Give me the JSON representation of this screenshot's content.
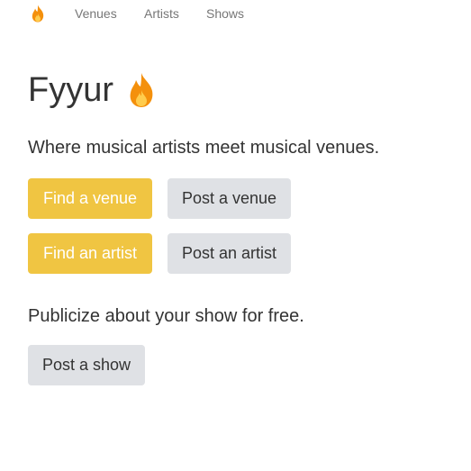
{
  "nav": {
    "brand_icon": "flame-icon",
    "links": [
      {
        "label": "Venues"
      },
      {
        "label": "Artists"
      },
      {
        "label": "Shows"
      }
    ]
  },
  "hero": {
    "title": "Fyyur",
    "title_icon": "flame-icon",
    "tagline": "Where musical artists meet musical venues."
  },
  "actions": {
    "find_venue": "Find a venue",
    "post_venue": "Post a venue",
    "find_artist": "Find an artist",
    "post_artist": "Post an artist"
  },
  "shows": {
    "text": "Publicize about your show for free.",
    "post_show": "Post a show"
  },
  "colors": {
    "primary": "#f0c542",
    "secondary": "#dfe1e5",
    "nav_text": "#777777",
    "body_text": "#333333"
  }
}
